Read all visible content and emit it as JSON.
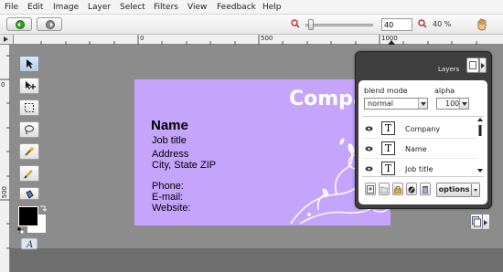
{
  "menu": [
    "File",
    "Edit",
    "Image",
    "Layer",
    "Select",
    "Filters",
    "View",
    "Feedback",
    "Help"
  ],
  "toolbar": {
    "zoom_value": "40",
    "zoom_label": "40 %"
  },
  "ruler": {
    "top_labels": [
      "0",
      "500",
      "1000"
    ],
    "left_labels": [
      "0",
      "500"
    ]
  },
  "card": {
    "company": "Company",
    "name": "Name",
    "job_title": "Job title",
    "address": "Address",
    "city": "City, State ZIP",
    "phone": "Phone:",
    "email": "E-mail:",
    "website": "Website:"
  },
  "layers_panel": {
    "title": "Layers",
    "blend_mode_label": "blend mode",
    "blend_mode_value": "normal",
    "alpha_label": "alpha",
    "alpha_value": "100",
    "layers": [
      "Company",
      "Name",
      "Job title"
    ],
    "options_label": "options"
  },
  "colors": {
    "card_bg": "#c5a4fc",
    "foreground": "#000000",
    "background": "#ffffff"
  }
}
